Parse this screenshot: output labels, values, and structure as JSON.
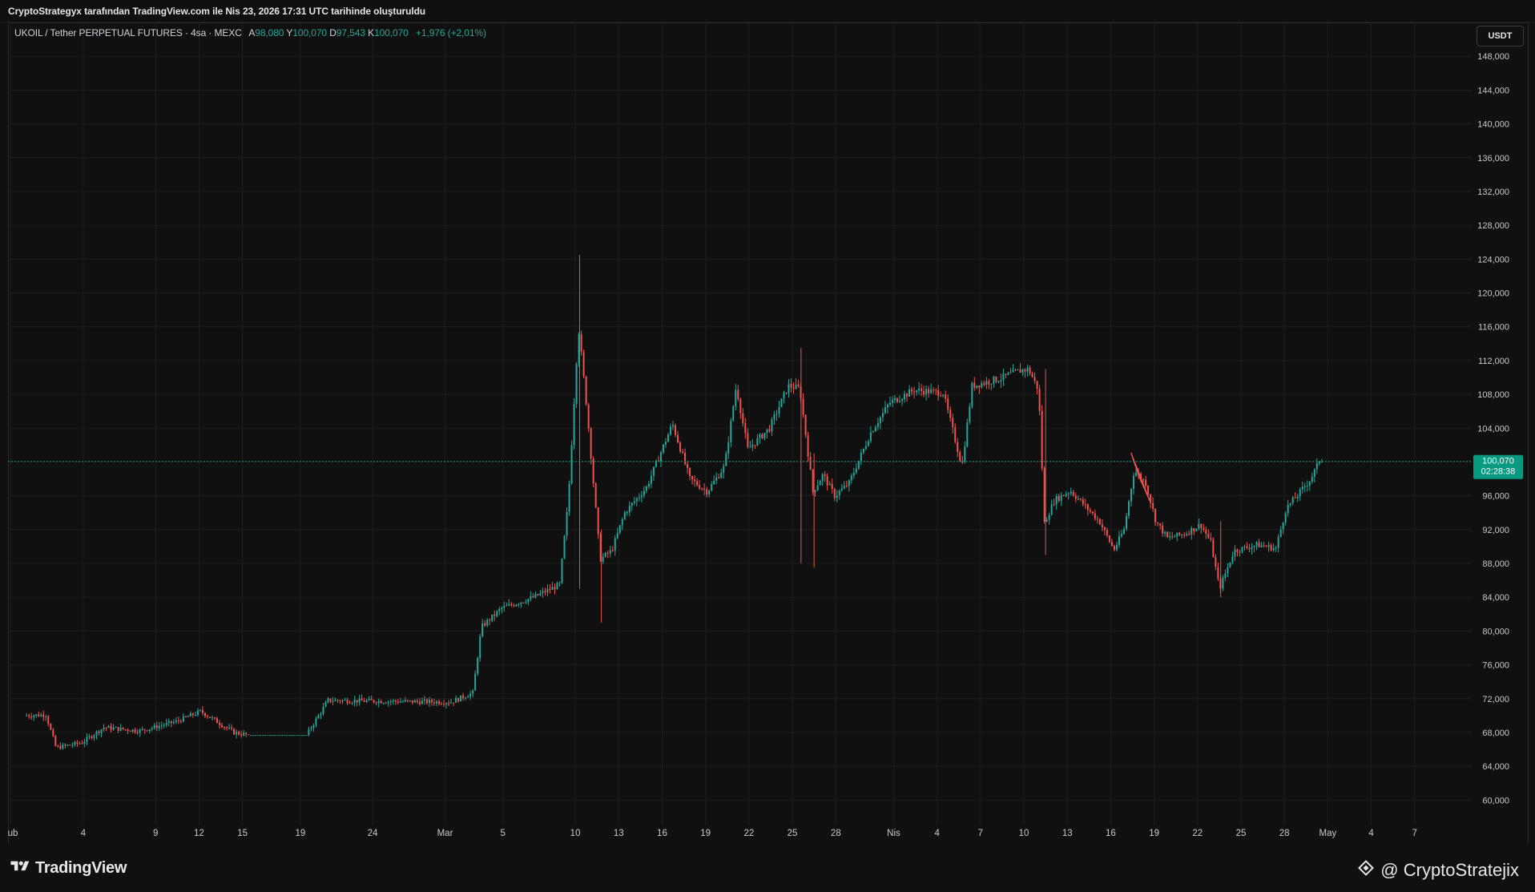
{
  "header": {
    "caption": "CryptoStrategyx tarafından TradingView.com ile Nis 23, 2026 17:31 UTC tarihinde oluşturuldu"
  },
  "legend": {
    "symbol": "UKOIL / Tether PERPETUAL FUTURES · 4sa · MEXC",
    "open_label": "A",
    "open_value": "98,080",
    "high_label": "Y",
    "high_value": "100,070",
    "low_label": "D",
    "low_value": "97,543",
    "close_label": "K",
    "close_value": "100,070",
    "change": "+1,976 (+2,01%)"
  },
  "currency_button": "USDT",
  "last_price": {
    "value": "100,070",
    "countdown": "02:28:38"
  },
  "colors": {
    "up": "#26a69a",
    "down": "#ef5350",
    "background": "#101010",
    "grid": "#1d1d1d",
    "price_tag": "#089981"
  },
  "footer": {
    "brand": "TradingView",
    "author": "@ CryptoStratejix"
  },
  "chart_data": {
    "type": "candlestick",
    "timeframe": "4sa",
    "ylim": [
      57000,
      152000
    ],
    "y_ticks": [
      60000,
      64000,
      68000,
      72000,
      76000,
      80000,
      84000,
      88000,
      92000,
      96000,
      100000,
      104000,
      108000,
      112000,
      116000,
      120000,
      124000,
      128000,
      132000,
      136000,
      140000,
      144000,
      148000
    ],
    "y_tick_labels": [
      "60,000",
      "64,000",
      "68,000",
      "72,000",
      "76,000",
      "80,000",
      "84,000",
      "88,000",
      "92,000",
      "96,000",
      "100,000",
      "104,000",
      "108,000",
      "112,000",
      "116,000",
      "120,000",
      "124,000",
      "128,000",
      "132,000",
      "136,000",
      "140,000",
      "144,000",
      "148,000"
    ],
    "x_tick_labels": [
      "ub",
      "4",
      "9",
      "12",
      "15",
      "19",
      "24",
      "Mar",
      "5",
      "10",
      "13",
      "16",
      "19",
      "22",
      "25",
      "28",
      "Nis",
      "4",
      "7",
      "10",
      "13",
      "16",
      "19",
      "22",
      "25",
      "28",
      "May",
      "4",
      "7"
    ],
    "x_tick_days": [
      -1,
      4,
      9,
      12,
      15,
      19,
      24,
      29,
      33,
      38,
      41,
      44,
      47,
      50,
      53,
      56,
      60,
      63,
      66,
      69,
      72,
      75,
      78,
      81,
      84,
      87,
      90,
      93,
      96
    ],
    "x_range_days": [
      -1.2,
      100
    ],
    "last_price_value": 100070,
    "bar_hours": 4,
    "anchors": [
      [
        0,
        70000
      ],
      [
        1.5,
        70100
      ],
      [
        2.2,
        66200
      ],
      [
        4,
        66800
      ],
      [
        5.5,
        68600
      ],
      [
        8,
        68200
      ],
      [
        10.5,
        69300
      ],
      [
        12.2,
        70500
      ],
      [
        14.5,
        68000
      ],
      [
        15.5,
        67700
      ],
      [
        19.5,
        67700
      ],
      [
        21,
        71800
      ],
      [
        25,
        71700
      ],
      [
        29.5,
        71600
      ],
      [
        31,
        72700
      ],
      [
        31.6,
        80500
      ],
      [
        33,
        82700
      ],
      [
        35.2,
        84000
      ],
      [
        37,
        85500
      ],
      [
        37.6,
        95500
      ],
      [
        38.3,
        116000
      ],
      [
        38.9,
        106000
      ],
      [
        39.8,
        88500
      ],
      [
        40.6,
        89500
      ],
      [
        41.5,
        94000
      ],
      [
        43,
        97000
      ],
      [
        44.8,
        104500
      ],
      [
        46,
        98000
      ],
      [
        47.2,
        96500
      ],
      [
        48.4,
        99500
      ],
      [
        49.2,
        109000
      ],
      [
        50,
        101500
      ],
      [
        51.5,
        104000
      ],
      [
        52.8,
        109000
      ],
      [
        53.6,
        108700
      ],
      [
        54.5,
        96500
      ],
      [
        55.2,
        98500
      ],
      [
        56,
        96000
      ],
      [
        57,
        97500
      ],
      [
        58.5,
        103500
      ],
      [
        59.8,
        107000
      ],
      [
        61.5,
        108500
      ],
      [
        63.5,
        108200
      ],
      [
        64.2,
        103500
      ],
      [
        64.8,
        99500
      ],
      [
        65.5,
        109000
      ],
      [
        67.5,
        109900
      ],
      [
        68.8,
        110800
      ],
      [
        69.4,
        111000
      ],
      [
        70.1,
        108500
      ],
      [
        70.5,
        92800
      ],
      [
        71.2,
        95500
      ],
      [
        72.3,
        96600
      ],
      [
        74.3,
        93000
      ],
      [
        75.3,
        89600
      ],
      [
        76,
        92000
      ],
      [
        76.7,
        99000
      ],
      [
        77.5,
        97500
      ],
      [
        78.2,
        93000
      ],
      [
        79,
        91000
      ],
      [
        80.2,
        91500
      ],
      [
        81.3,
        92600
      ],
      [
        82,
        90500
      ],
      [
        82.6,
        85000
      ],
      [
        83.6,
        89500
      ],
      [
        85.2,
        90200
      ],
      [
        86.5,
        89800
      ],
      [
        87.2,
        94500
      ],
      [
        88.2,
        96500
      ],
      [
        88.9,
        98000
      ],
      [
        89.5,
        100070
      ]
    ],
    "drawing": {
      "type": "triangle-pattern",
      "color": "#ef5350",
      "points_day_price": [
        [
          76.4,
          101100
        ],
        [
          76.95,
          98300
        ],
        [
          77.7,
          95400
        ]
      ]
    }
  }
}
